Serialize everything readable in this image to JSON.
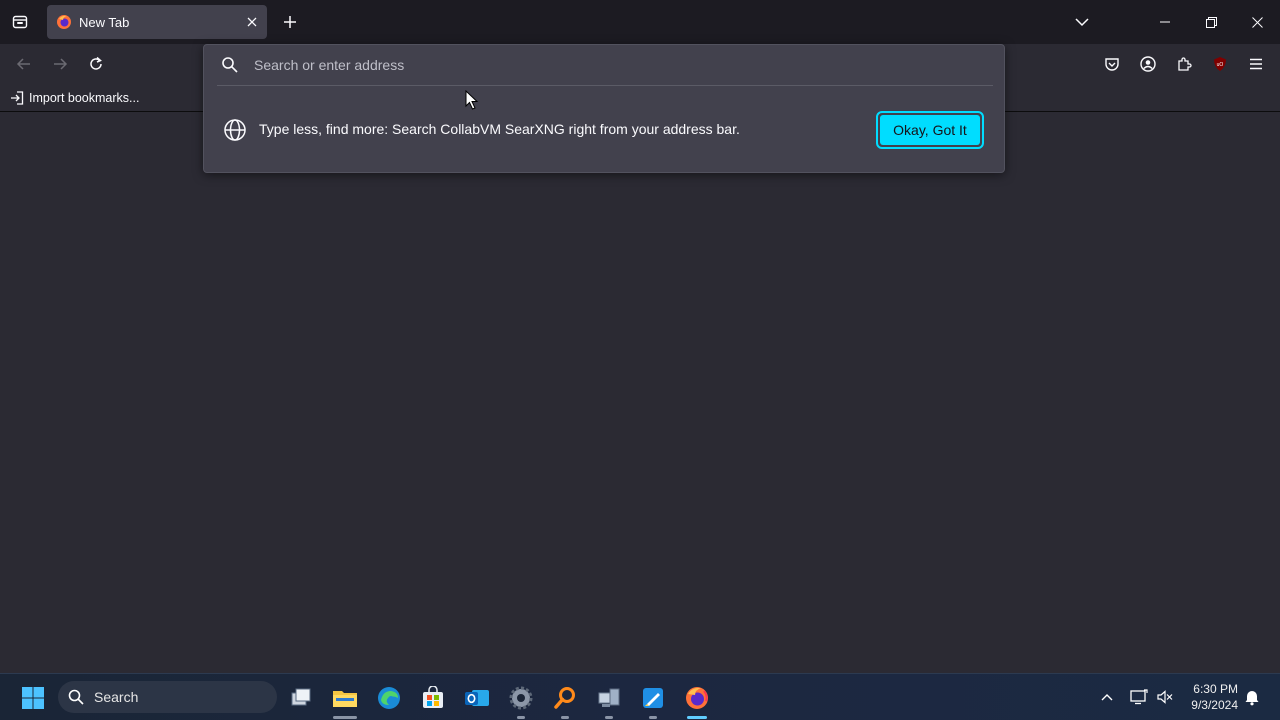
{
  "tab": {
    "title": "New Tab"
  },
  "bookmarks": {
    "import_label": "Import bookmarks..."
  },
  "urlbar": {
    "placeholder": "Search or enter address",
    "tip_text": "Type less, find more: Search CollabVM SearXNG right from your address bar.",
    "tip_button": "Okay, Got It"
  },
  "taskbar": {
    "search_label": "Search",
    "clock_time": "6:30 PM",
    "clock_date": "9/3/2024"
  },
  "colors": {
    "accent": "#00ddff",
    "tab_active": "#42414d",
    "tabstrip": "#1c1b22",
    "content_bg": "#2b2a33"
  }
}
